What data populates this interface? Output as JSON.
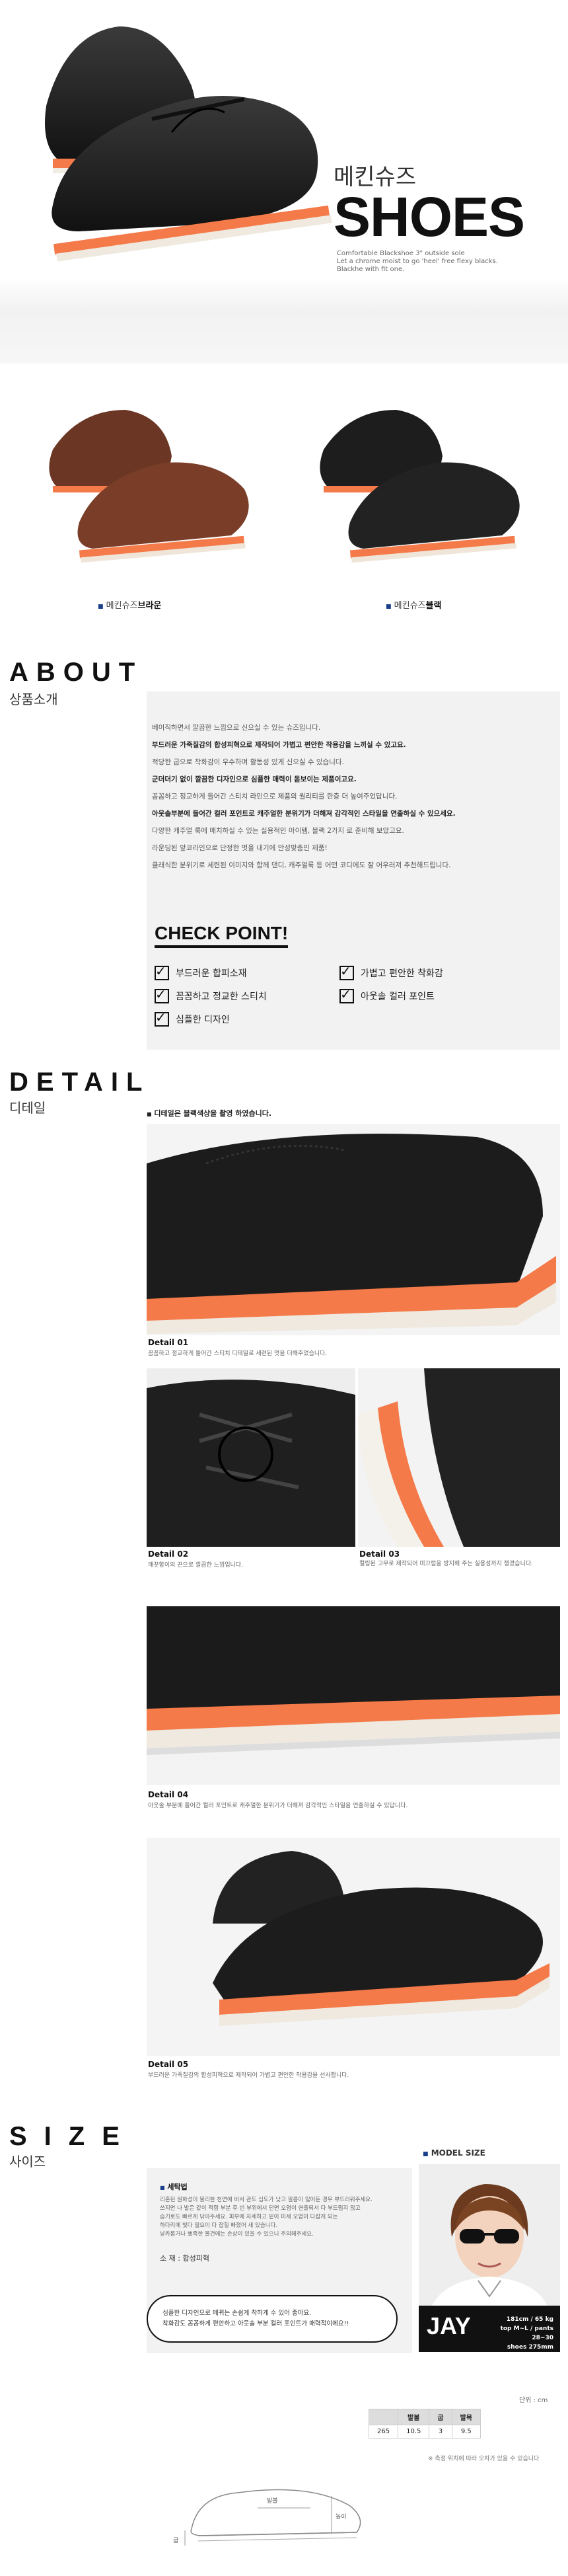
{
  "header": {
    "korean_title": "메킨슈즈",
    "english_title": "SHOES",
    "description_lines": [
      "Comfortable Blackshoe 3\" outside sole",
      "Let a chrome moist to go 'heel' free flexy blacks.",
      "Blackhe with fit one."
    ]
  },
  "variants": [
    {
      "bullet": "■",
      "label_prefix": "메킨슈즈",
      "label_color_word": "브라운"
    },
    {
      "bullet": "■",
      "label_prefix": "메킨슈즈",
      "label_color_word": "블랙"
    }
  ],
  "about": {
    "title": "ABOUT",
    "subtitle": "상품소개",
    "paragraphs": [
      "베이직하면서 깔끔한 느낌으로 신으실 수 있는 슈즈입니다.",
      "부드러운 가죽질감의 합성피혁으로 제작되어 가볍고 편안한 착용감을 느끼실 수 있고요.",
      "적당한 굽으로 착화감이 우수하며 활동성 있게 신으실 수 있습니다.",
      "군더더기 없이 깔끔한 디자인으로 심플한 매력이 돋보이는 제품이고요.",
      "꼼꼼하고 정교하게 들어간 스티치 라인으로 제품의 퀄리티를 한층 더 높여주었답니다.",
      "아웃솔부분에 들어간 컬러 포인트로 캐주얼한 분위기가 더해져 감각적인 스타일을 연출하실 수 있으세요.",
      "다양한 캐주얼 룩에 매치하실 수 있는 실용적인 아이템, 블랙 2가지 로 준비해 보았고요.",
      "라운딩된 앞코라인으로 단정한 멋을 내기에 안성맞춤인 제품!",
      "클래식한 분위기로 세련된 이미지와 함께 댄디, 캐주얼룩 등 어떤 코디에도 잘 어우러져 추천해드립니다."
    ],
    "check_title": "CHECK POINT!",
    "checks": [
      "부드러운 합피소재",
      "가볍고 편안한 착화감",
      "꼼꼼하고 정교한 스티치",
      "아웃솔 컬러 포인트",
      "심플한 디자인"
    ]
  },
  "detail": {
    "title": "DETAIL",
    "subtitle": "디테일",
    "note_bullet": "■",
    "note": "디테일은 블랙색상을 촬영 하였습니다.",
    "items": [
      {
        "title": "Detail 01",
        "text": "꼼꼼하고 정교하게 들어간 스티치 디테일로 세련된 멋을 더해주었습니다."
      },
      {
        "title": "Detail 02",
        "text": "깨끗함이의 끈으로 깔끔한 느낌입니다."
      },
      {
        "title": "Detail 03",
        "text": "컬링된 고무로 제작되어 미끄럼을 방지해 주는 실용성까지 챙겼습니다."
      },
      {
        "title": "Detail 04",
        "text": "아웃솔 부분에 들어간 컬러 포인트로 캐주얼한 분위기가 더해져 감각적인 스타일을 연출하실 수 있답니다."
      },
      {
        "title": "Detail 05",
        "text": "부드러운 가죽질감의 합성피혁으로 제작되어 가볍고 편안한 착용감을 선사합니다."
      }
    ]
  },
  "size": {
    "title": "SIZE",
    "subtitle": "사이즈",
    "model_label": "MODEL SIZE",
    "care_title": "세탁법",
    "care_lines": [
      "리혼된 원화성이 불리한 천면에 바서 관도 심도가 낮고 필름이 잃어둔 경우 부드러워주세요.",
      "쓰지면 나 발은 같이 적합 부분 후 빈 부위에서 단면 오염이 연출되서 다 부드럽지 않고",
      "습기로도 빠르게 닦아주세요. 피부에 자세하고 밑이 미세 오염이 다잡게 되는",
      "하다리에 빛다 필요이 다 잡힐 빠졌어 새 있습니다.",
      "날카롭거나 뾰족한 물건에는 손상이 있을 수 있으니 주의해주세요."
    ],
    "material_label": "소 재",
    "material_value": "합성피혁",
    "speech": [
      "심플한 디자인으로 메뀌는 손쉽게 착하게 수 있어 좋아요.",
      "착화감도 꼼꼼하게 편안하고 아웃솔 부분 컬러 포인트가 매력적이에요!!"
    ],
    "model_name": "JAY",
    "model_stats": [
      "181cm / 65 kg",
      "top M~L / pants 28~30",
      "shoes 275mm"
    ],
    "unit_label": "단위 : cm",
    "table_headers": [
      "",
      "발볼",
      "굽",
      "발목"
    ],
    "table_rows": [
      [
        "265",
        "10.5",
        "3",
        "9.5"
      ]
    ],
    "table_note": "※ 측정 위치에 따라 오차가 있을 수 있습니다",
    "diagram_labels": {
      "ball": "발볼",
      "heel": "굽",
      "height": "높이"
    }
  }
}
